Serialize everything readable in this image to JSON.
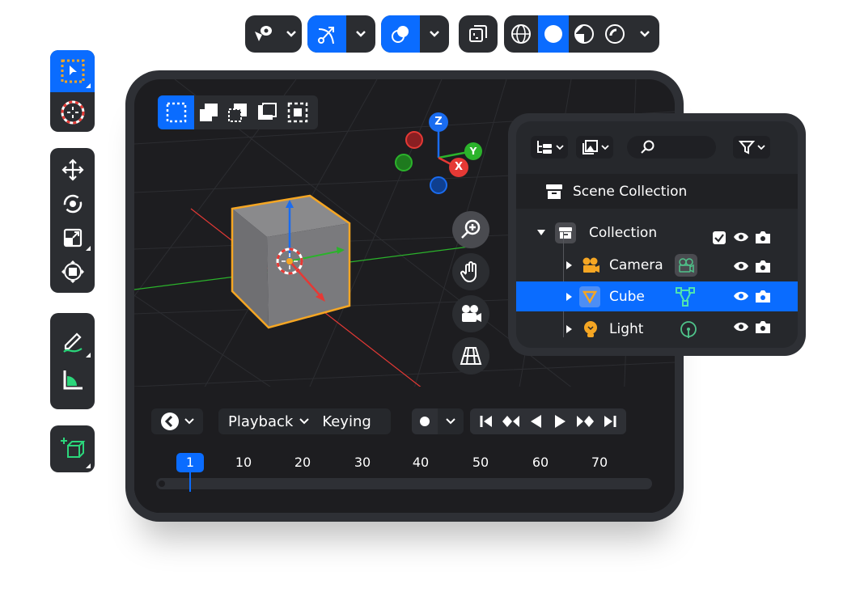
{
  "header_toolbar": {
    "icons": [
      "view-eye-pointer-icon",
      "chevron-down-icon",
      "transform-curve-icon",
      "chevron-down-icon",
      "overlay-circles-icon",
      "chevron-down-icon",
      "xray-toggle-icon",
      "wireframe-globe-icon",
      "solid-shading-icon",
      "material-preview-icon",
      "rendered-shading-icon",
      "chevron-down-icon"
    ],
    "active": [
      "transform-curve-icon",
      "overlay-circles-icon",
      "solid-shading-icon"
    ]
  },
  "left_toolbar": {
    "tools": [
      "select-box",
      "cursor",
      "move",
      "rotate",
      "scale",
      "transform",
      "annotate",
      "measure",
      "add-cube"
    ],
    "active": "select-box"
  },
  "select_modes": [
    "new-selection",
    "extend",
    "subtract",
    "invert",
    "intersect"
  ],
  "gizmo": {
    "z": "Z",
    "y": "Y",
    "x": "X"
  },
  "outliner": {
    "scene_collection": "Scene Collection",
    "items": [
      {
        "label": "Collection",
        "type": "collection",
        "checked": true
      },
      {
        "label": "Camera",
        "type": "camera"
      },
      {
        "label": "Cube",
        "type": "mesh",
        "selected": true
      },
      {
        "label": "Light",
        "type": "light"
      }
    ]
  },
  "timeline": {
    "playback_label": "Playback",
    "keying_label": "Keying",
    "current_frame": "1",
    "ticks": [
      "10",
      "20",
      "30",
      "40",
      "50",
      "60",
      "70"
    ]
  },
  "colors": {
    "accent": "#0a6cff",
    "selection": "#f5a623",
    "x_axis": "#e53935",
    "y_axis": "#2bb32b",
    "z_axis": "#1a6cf0"
  }
}
